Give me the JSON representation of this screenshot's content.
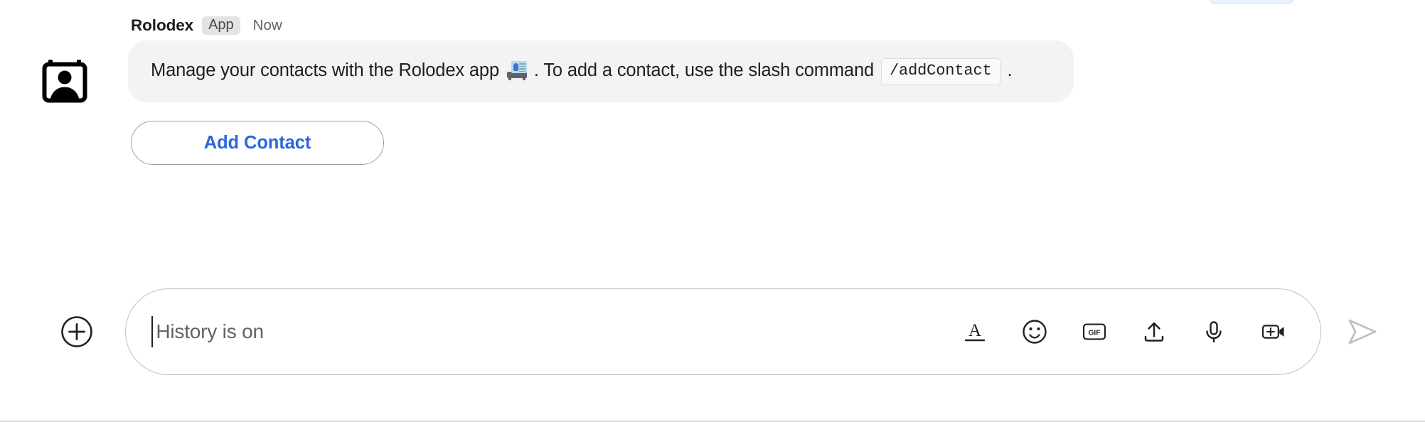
{
  "colors": {
    "accent_blue": "#2b66dd",
    "bubble_bg": "#f1f3f4",
    "badge_bg": "#e3e3e1",
    "text_primary": "#1f1f1f",
    "text_secondary": "#5f6368",
    "border_gray": "#bdc1c6",
    "emoji_card": "#bcdbe8"
  },
  "message": {
    "avatar_icon": "rolodex-card-person-icon",
    "sender": "Rolodex",
    "badge": "App",
    "timestamp": "Now",
    "text_before_emoji": "Manage your contacts with the Rolodex app",
    "emoji_icon": "card-index-emoji",
    "text_after_emoji": ". To add a contact, use the slash command",
    "command_chip": "/addContact",
    "text_end": ".",
    "full_text": "Manage your contacts with the Rolodex app 📇. To add a contact, use the slash command /addContact ."
  },
  "actions": [
    {
      "label": "Add Contact",
      "name": "add-contact-button"
    }
  ],
  "composer": {
    "add_icon": "plus-circle-icon",
    "placeholder": "History is on",
    "value": "",
    "tools": [
      {
        "name": "format-text-icon",
        "label": "A"
      },
      {
        "name": "emoji-icon",
        "label": ""
      },
      {
        "name": "gif-icon",
        "label": "GIF"
      },
      {
        "name": "upload-icon",
        "label": ""
      },
      {
        "name": "microphone-icon",
        "label": ""
      },
      {
        "name": "video-add-icon",
        "label": ""
      }
    ],
    "send_icon": "send-arrow-icon"
  }
}
